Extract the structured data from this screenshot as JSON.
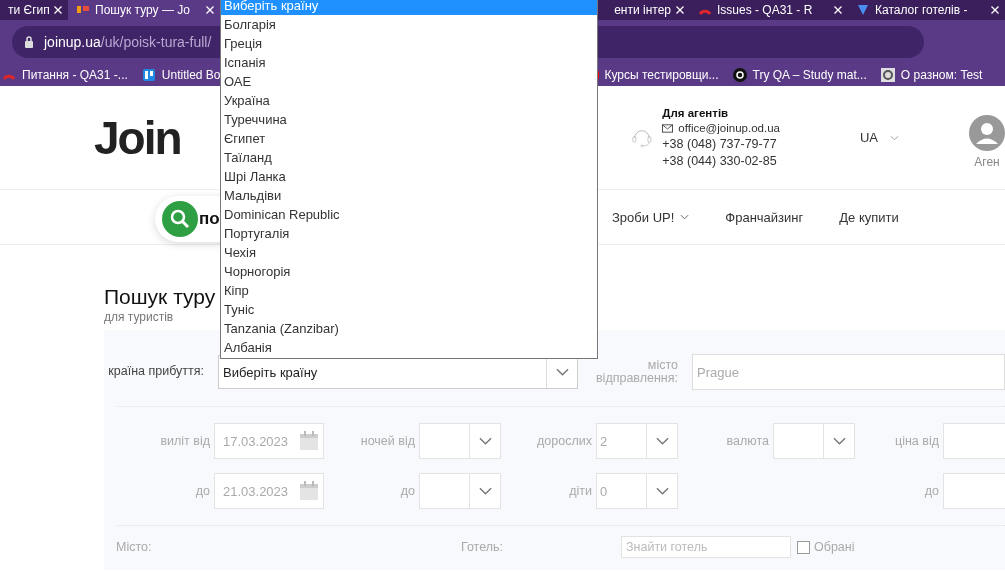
{
  "browser": {
    "tabs": [
      {
        "title": "ти Єгип",
        "selected": false
      },
      {
        "title": "Пошук туру — Jo",
        "selected": true
      },
      {
        "title": "енти інтер",
        "selected": false
      },
      {
        "title": "Issues - QA31 - R",
        "selected": false
      },
      {
        "title": "Каталог готелів -",
        "selected": false
      }
    ],
    "address": {
      "host": "joinup.ua",
      "path": "/uk/poisk-tura-full/"
    },
    "bookmarks": [
      {
        "title": "Питання - QA31 -..."
      },
      {
        "title": "Untitled Bo"
      },
      {
        "title": "Курсы тестировщи..."
      },
      {
        "title": "Try QA – Study mat..."
      },
      {
        "title": "О разном: Test"
      }
    ]
  },
  "header": {
    "logo": "Join",
    "agents": {
      "title": "Для агентів",
      "email": "office@joinup.od.ua",
      "phones": [
        "+38 (048) 737-79-77",
        "+38 (044) 330-02-85"
      ]
    },
    "language": "UA",
    "account": "Аген"
  },
  "nav": {
    "search_label": "по",
    "items": [
      {
        "label": "Зроби UP!",
        "has_menu": true
      },
      {
        "label": "Франчайзинг",
        "has_menu": false
      },
      {
        "label": "Де купити",
        "has_menu": false
      }
    ]
  },
  "page": {
    "title": "Пошук туру",
    "subtitle": "для туристів"
  },
  "form": {
    "country": {
      "label": "країна прибуття:",
      "value": "Виберіть країну"
    },
    "city": {
      "label": "місто відправлення:",
      "value": "Prague"
    },
    "columns": [
      {
        "fields": [
          {
            "label": "виліт від",
            "kind": "date",
            "value": "17.03.2023"
          },
          {
            "label": "до",
            "kind": "date",
            "value": "21.03.2023"
          }
        ]
      },
      {
        "fields": [
          {
            "label": "ночей від",
            "kind": "select"
          },
          {
            "label": "до",
            "kind": "select"
          }
        ]
      },
      {
        "fields": [
          {
            "label": "дорослих",
            "kind": "select",
            "value": "2"
          },
          {
            "label": "діти",
            "kind": "select",
            "value": "0"
          }
        ]
      },
      {
        "fields": [
          {
            "label": "валюта",
            "kind": "select"
          }
        ]
      },
      {
        "fields": [
          {
            "label": "ціна від",
            "kind": "input"
          },
          {
            "label": "до",
            "kind": "input"
          }
        ]
      }
    ],
    "place_label": "Місто:",
    "hotel_label": "Готель:",
    "hotel_placeholder": "Знайти готель",
    "favourites": {
      "label": "Обрані",
      "checked": false
    }
  },
  "dropdown": {
    "options": [
      {
        "label": "Виберіть країну",
        "selected": true
      },
      {
        "label": "Болгарія",
        "selected": false
      },
      {
        "label": "Греція",
        "selected": false
      },
      {
        "label": "Іспанія",
        "selected": false
      },
      {
        "label": "ОАЕ",
        "selected": false
      },
      {
        "label": "Україна",
        "selected": false
      },
      {
        "label": "Туреччина",
        "selected": false
      },
      {
        "label": "Єгипет",
        "selected": false
      },
      {
        "label": "Таїланд",
        "selected": false
      },
      {
        "label": "Шрі Ланка",
        "selected": false
      },
      {
        "label": "Мальдіви",
        "selected": false
      },
      {
        "label": "Dominican Republic",
        "selected": false
      },
      {
        "label": "Португалія",
        "selected": false
      },
      {
        "label": "Чехія",
        "selected": false
      },
      {
        "label": "Чорногорія",
        "selected": false
      },
      {
        "label": "Кіпр",
        "selected": false
      },
      {
        "label": "Туніс",
        "selected": false
      },
      {
        "label": "Tanzania (Zanzibar)",
        "selected": false
      },
      {
        "label": "Албанія",
        "selected": false
      }
    ]
  }
}
